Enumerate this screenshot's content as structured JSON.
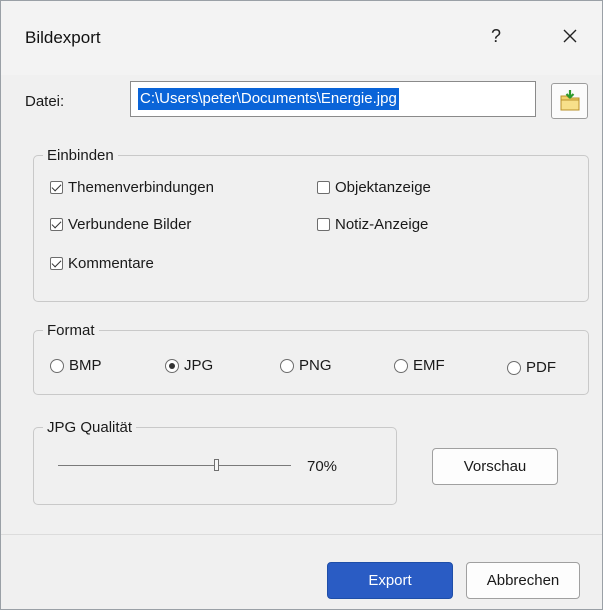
{
  "dialog": {
    "title": "Bildexport",
    "help_glyph": "?",
    "close_icon": "close-icon"
  },
  "file": {
    "label": "Datei:",
    "value": "C:\\Users\\peter\\Documents\\Energie.jpg",
    "browse_icon": "folder-arrow-icon"
  },
  "include": {
    "legend": "Einbinden",
    "options": [
      {
        "label": "Themenverbindungen",
        "checked": true
      },
      {
        "label": "Verbundene Bilder",
        "checked": true
      },
      {
        "label": "Kommentare",
        "checked": true
      },
      {
        "label": "Objektanzeige",
        "checked": false
      },
      {
        "label": "Notiz-Anzeige",
        "checked": false
      }
    ]
  },
  "format": {
    "legend": "Format",
    "options": [
      "BMP",
      "JPG",
      "PNG",
      "EMF",
      "PDF"
    ],
    "selected": "JPG"
  },
  "quality": {
    "legend": "JPG Qualität",
    "slider_fraction": 0.68,
    "value_text": "70%",
    "preview_label": "Vorschau"
  },
  "buttons": {
    "export": "Export",
    "cancel": "Abbrechen"
  },
  "colors": {
    "accent": "#2a5cc4",
    "selection": "#0a64d8"
  }
}
